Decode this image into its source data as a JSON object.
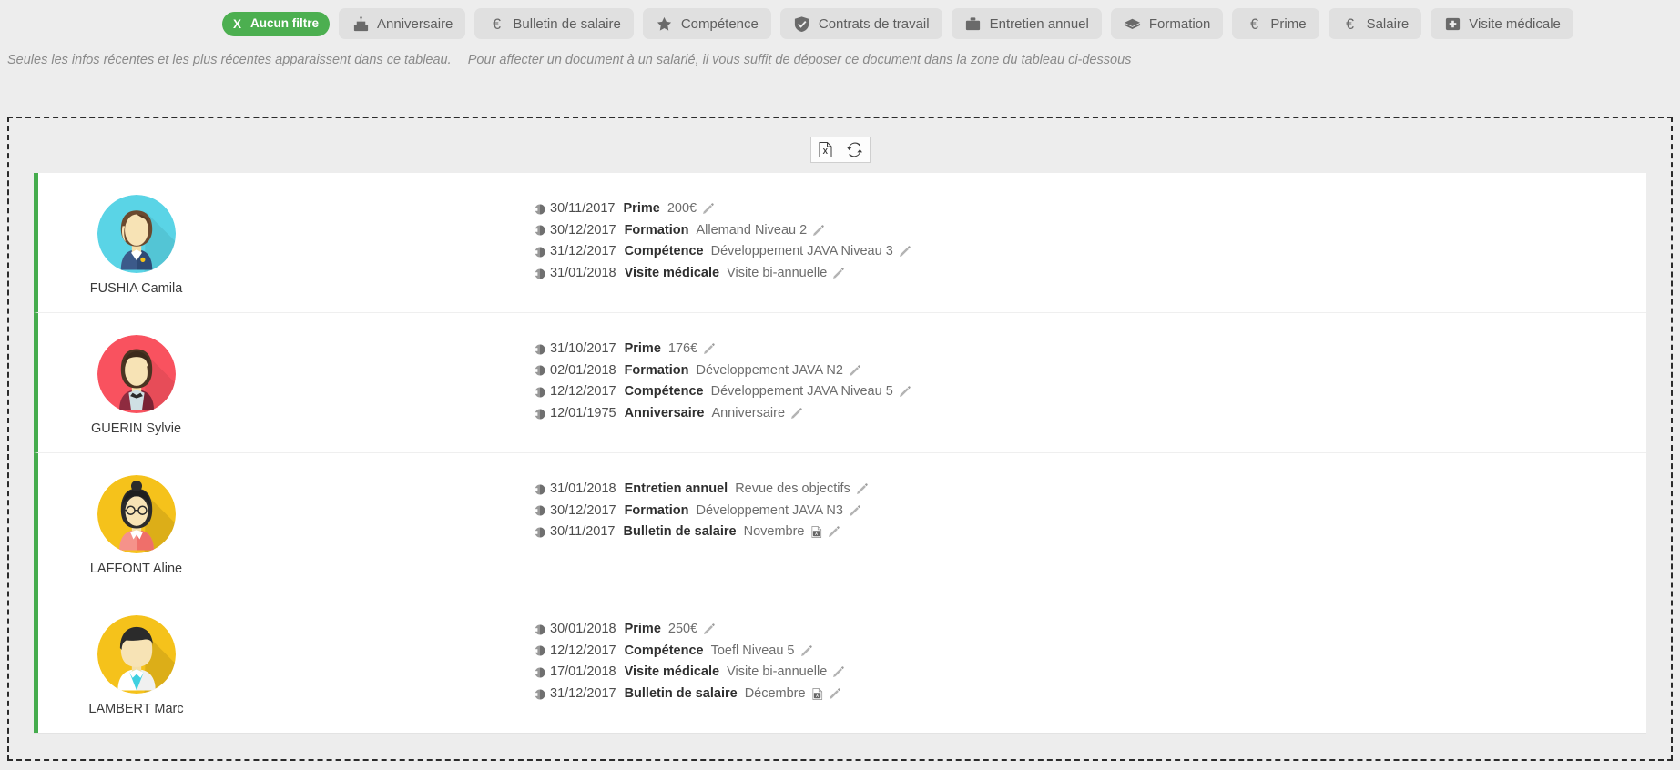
{
  "filters": [
    {
      "label": "Aucun filtre",
      "icon": "close-x-icon",
      "active": true
    },
    {
      "label": "Anniversaire",
      "icon": "birthday-cake-icon",
      "active": false
    },
    {
      "label": "Bulletin de salaire",
      "icon": "euro-icon",
      "active": false
    },
    {
      "label": "Compétence",
      "icon": "star-icon",
      "active": false
    },
    {
      "label": "Contrats de travail",
      "icon": "shield-check-icon",
      "active": false
    },
    {
      "label": "Entretien annuel",
      "icon": "briefcase-icon",
      "active": false
    },
    {
      "label": "Formation",
      "icon": "graduation-cap-icon",
      "active": false
    },
    {
      "label": "Prime",
      "icon": "euro-icon",
      "active": false
    },
    {
      "label": "Salaire",
      "icon": "euro-icon",
      "active": false
    },
    {
      "label": "Visite médicale",
      "icon": "medical-cross-icon",
      "active": false
    }
  ],
  "filter_active_x": "X",
  "hint": {
    "part1": "Seules les infos récentes et les plus récentes apparaissent dans ce tableau.",
    "part2": "Pour affecter un document à un salarié, il vous suffit de déposer ce document dans la zone du tableau ci-dessous"
  },
  "toolbar": {
    "export_excel": "excel-export-icon",
    "refresh": "refresh-icon"
  },
  "colors": {
    "accent_green": "#45ac4d",
    "chip_active_bg": "#4caf50",
    "chip_bg": "#e0e0e0",
    "page_bg": "#ededed"
  },
  "employees": [
    {
      "name": "FUSHIA Camila",
      "avatar": "avatar-camila",
      "avatar_bg": "#5ad4e6",
      "events": [
        {
          "date": "30/11/2017",
          "type": "Prime",
          "value": "200€",
          "pdf": false
        },
        {
          "date": "30/12/2017",
          "type": "Formation",
          "value": "Allemand Niveau 2",
          "pdf": false
        },
        {
          "date": "31/12/2017",
          "type": "Compétence",
          "value": "Développement JAVA Niveau 3",
          "pdf": false
        },
        {
          "date": "31/01/2018",
          "type": "Visite médicale",
          "value": "Visite bi-annuelle",
          "pdf": false
        }
      ]
    },
    {
      "name": "GUERIN Sylvie",
      "avatar": "avatar-sylvie",
      "avatar_bg": "#f9525f",
      "events": [
        {
          "date": "31/10/2017",
          "type": "Prime",
          "value": "176€",
          "pdf": false
        },
        {
          "date": "02/01/2018",
          "type": "Formation",
          "value": "Développement JAVA N2",
          "pdf": false
        },
        {
          "date": "12/12/2017",
          "type": "Compétence",
          "value": "Développement JAVA Niveau 5",
          "pdf": false
        },
        {
          "date": "12/01/1975",
          "type": "Anniversaire",
          "value": "Anniversaire",
          "pdf": false
        }
      ]
    },
    {
      "name": "LAFFONT Aline",
      "avatar": "avatar-aline",
      "avatar_bg": "#f5c21b",
      "events": [
        {
          "date": "31/01/2018",
          "type": "Entretien annuel",
          "value": "Revue des objectifs",
          "pdf": false
        },
        {
          "date": "30/12/2017",
          "type": "Formation",
          "value": "Développement JAVA N3",
          "pdf": false
        },
        {
          "date": "30/11/2017",
          "type": "Bulletin de salaire",
          "value": "Novembre",
          "pdf": true
        }
      ]
    },
    {
      "name": "LAMBERT Marc",
      "avatar": "avatar-marc",
      "avatar_bg": "#f5c21b",
      "events": [
        {
          "date": "30/01/2018",
          "type": "Prime",
          "value": "250€",
          "pdf": false
        },
        {
          "date": "12/12/2017",
          "type": "Compétence",
          "value": "Toefl Niveau 5",
          "pdf": false
        },
        {
          "date": "17/01/2018",
          "type": "Visite médicale",
          "value": "Visite bi-annuelle",
          "pdf": false
        },
        {
          "date": "31/12/2017",
          "type": "Bulletin de salaire",
          "value": "Décembre",
          "pdf": true
        }
      ]
    }
  ]
}
